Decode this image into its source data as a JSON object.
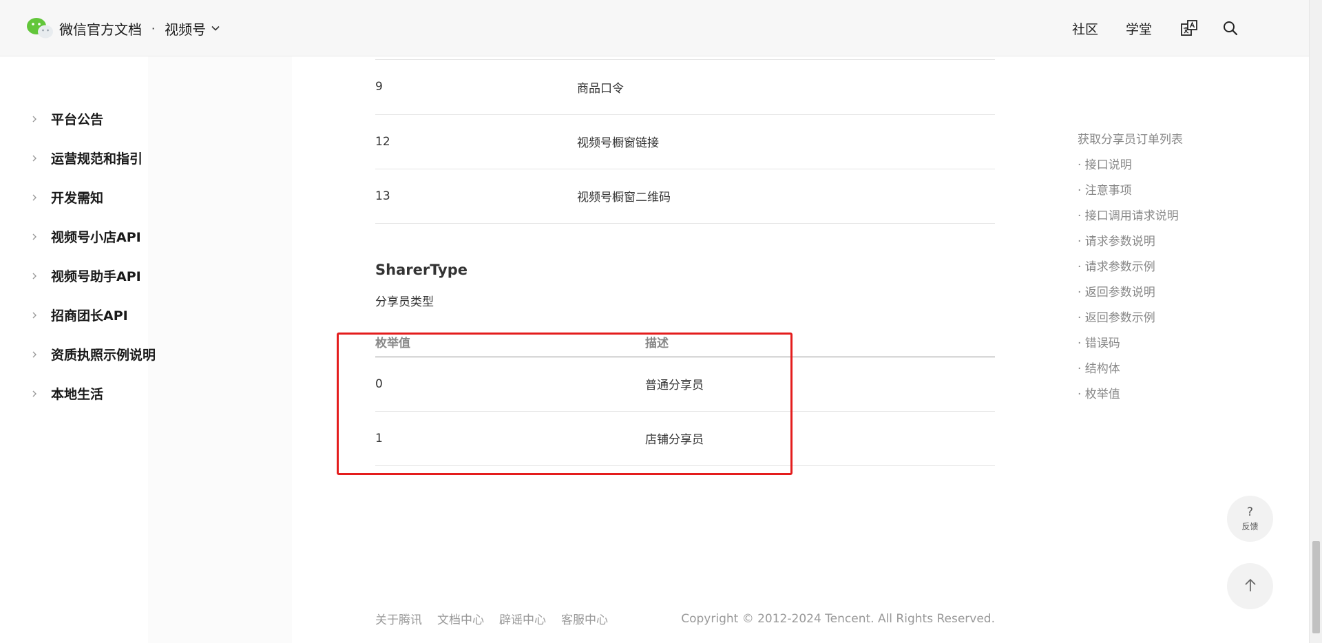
{
  "header": {
    "title": "微信官方文档",
    "separator": "·",
    "product": "视频号",
    "nav": [
      "社区",
      "学堂"
    ],
    "icons": [
      "translate-icon",
      "search-icon"
    ]
  },
  "sidebar": {
    "items": [
      {
        "label": "平台公告"
      },
      {
        "label": "运营规范和指引"
      },
      {
        "label": "开发需知"
      },
      {
        "label": "视频号小店API"
      },
      {
        "label": "视频号助手API"
      },
      {
        "label": "招商团长API"
      },
      {
        "label": "资质执照示例说明"
      },
      {
        "label": "本地生活"
      }
    ]
  },
  "table_top": {
    "rows": [
      {
        "value": "9",
        "desc": "商品口令"
      },
      {
        "value": "12",
        "desc": "视频号橱窗链接"
      },
      {
        "value": "13",
        "desc": "视频号橱窗二维码"
      }
    ]
  },
  "section": {
    "title": "SharerType",
    "desc": "分享员类型"
  },
  "table_sharer": {
    "headers": [
      "枚举值",
      "描述"
    ],
    "rows": [
      {
        "value": "0",
        "desc": "普通分享员"
      },
      {
        "value": "1",
        "desc": "店铺分享员"
      }
    ]
  },
  "toc": {
    "title": "获取分享员订单列表",
    "items": [
      "· 接口说明",
      "· 注意事项",
      "· 接口调用请求说明",
      "· 请求参数说明",
      "· 请求参数示例",
      "· 返回参数说明",
      "· 返回参数示例",
      "· 错误码",
      "· 结构体",
      "· 枚举值"
    ]
  },
  "float": {
    "feedback_q": "?",
    "feedback_label": "反馈"
  },
  "footer": {
    "links": [
      "关于腾讯",
      "文档中心",
      "辟谣中心",
      "客服中心"
    ],
    "copyright": "Copyright © 2012-2024 Tencent. All Rights Reserved."
  },
  "colors": {
    "highlight": "#e41d1d",
    "brand_green": "#62c63a"
  }
}
